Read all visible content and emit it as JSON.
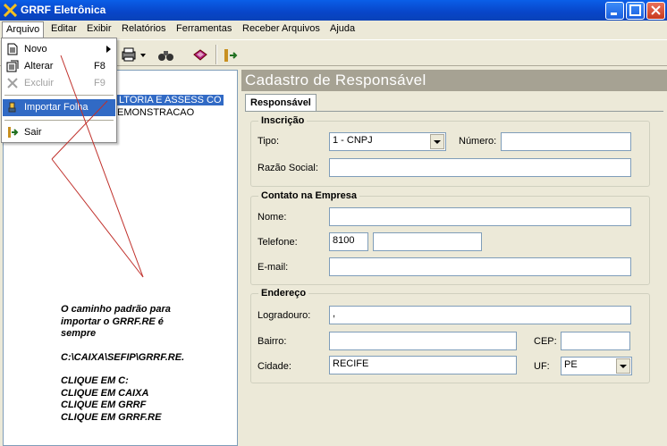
{
  "window": {
    "title": "GRRF Eletrônica"
  },
  "menubar": {
    "items": [
      "Arquivo",
      "Editar",
      "Exibir",
      "Relatórios",
      "Ferramentas",
      "Receber Arquivos",
      "Ajuda"
    ]
  },
  "arquivo_menu": {
    "items": [
      {
        "label": "Novo",
        "shortcut": ""
      },
      {
        "label": "Alterar",
        "shortcut": "F8"
      },
      {
        "label": "Excluir",
        "shortcut": "F9"
      },
      {
        "label": "Importar Folha",
        "shortcut": ""
      },
      {
        "label": "Sair",
        "shortcut": ""
      }
    ]
  },
  "tree": {
    "items": [
      "LTORIA E ASSESS CO",
      "EMONSTRACAO"
    ]
  },
  "form": {
    "header": "Cadastro de Responsável",
    "tab": "Responsável",
    "inscricao": {
      "legend": "Inscrição",
      "tipo_label": "Tipo:",
      "tipo_value": "1 - CNPJ",
      "numero_label": "Número:",
      "numero_value": "",
      "razao_label": "Razão Social:",
      "razao_value": ""
    },
    "contato": {
      "legend": "Contato na Empresa",
      "nome_label": "Nome:",
      "nome_value": "",
      "telefone_label": "Telefone:",
      "telefone_ddd": "8100",
      "telefone_value": "",
      "email_label": "E-mail:",
      "email_value": ""
    },
    "endereco": {
      "legend": "Endereço",
      "logradouro_label": "Logradouro:",
      "logradouro_value": ",",
      "bairro_label": "Bairro:",
      "bairro_value": "",
      "cep_label": "CEP:",
      "cep_value": "",
      "cidade_label": "Cidade:",
      "cidade_value": "RECIFE",
      "uf_label": "UF:",
      "uf_value": "PE"
    }
  },
  "annotation": {
    "line1": "O caminho padrão para",
    "line2": "importar o GRRF.RE é",
    "line3": "sempre",
    "path": "C:\\CAIXA\\SEFIP\\GRRF.RE.",
    "step1": "CLIQUE EM C:",
    "step2": "CLIQUE EM CAIXA",
    "step3": "CLIQUE EM GRRF",
    "step4": "CLIQUE EM GRRF.RE"
  },
  "colors": {
    "titlebar": "#0845c8",
    "menu_highlight": "#316ac5",
    "header_bg": "#a6a293",
    "annotation_line": "#c0302b"
  }
}
